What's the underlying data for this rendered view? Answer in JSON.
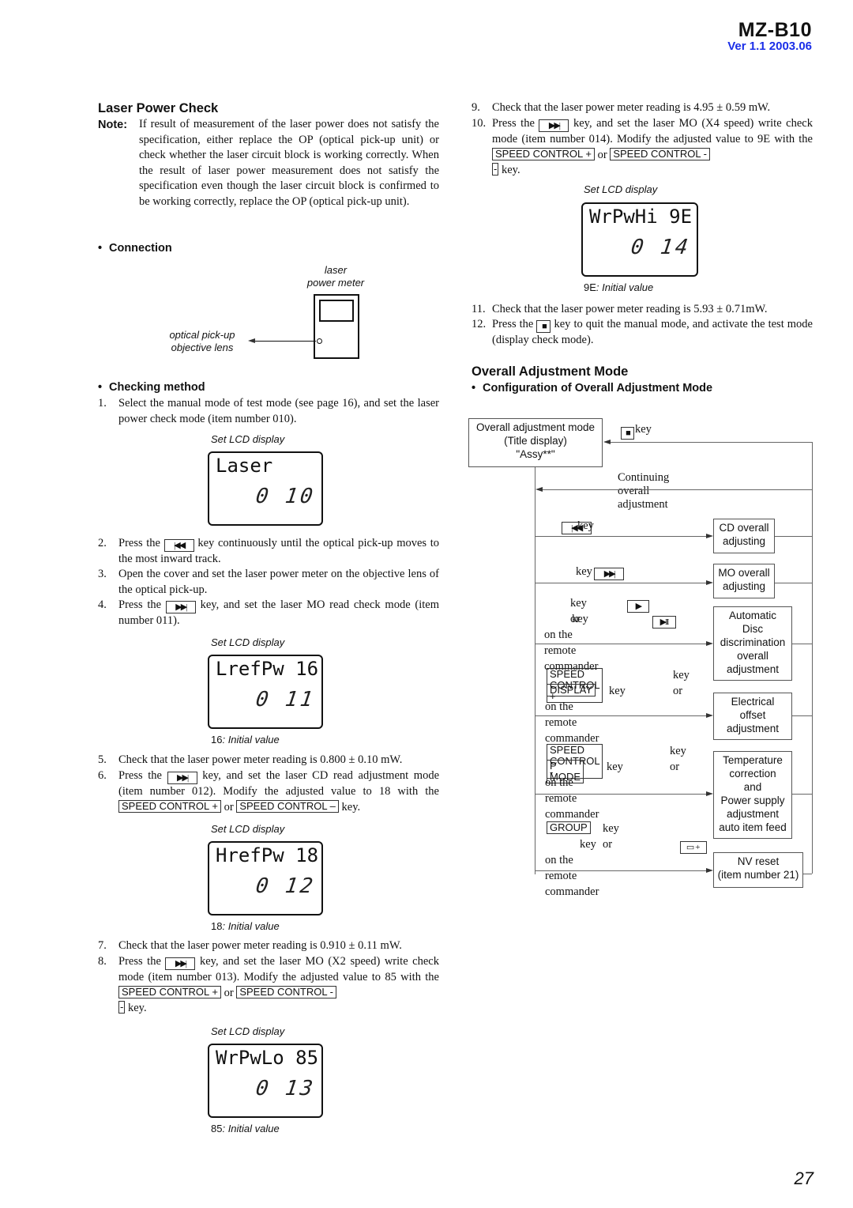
{
  "header": {
    "model": "MZ-B10",
    "version": "Ver 1.1  2003.06"
  },
  "laser_power_check": {
    "title": "Laser Power Check",
    "note_label": "Note:",
    "note_text": "If result of measurement of the laser power does not satisfy the specification, either replace the OP (optical pick-up unit) or check whether the laser circuit block is working correctly. When the result of laser power measurement does not satisfy the specification even though the laser circuit block is confirmed to be working correctly, replace the OP (optical pick-up unit).",
    "connection": {
      "heading": "Connection",
      "meter_label_1": "laser",
      "meter_label_2": "power meter",
      "lens_label_1": "optical pick-up",
      "lens_label_2": "objective lens"
    },
    "checking_method": {
      "heading": "Checking method",
      "steps": [
        {
          "num": "1.",
          "text": "Select the manual mode of test mode (see page 16), and set the laser power check mode (item number 010)."
        },
        {
          "num": "2.",
          "pre": "Press the",
          "key": "prev-track",
          "post": "key continuously until the optical pick-up moves to the most inward track."
        },
        {
          "num": "3.",
          "text": "Open the cover and set the laser power meter on the objective lens of the optical pick-up."
        },
        {
          "num": "4.",
          "pre": "Press the",
          "key": "next-track",
          "post": "key, and set the laser MO read check mode (item number 011)."
        },
        {
          "num": "5.",
          "text": "Check that the laser power meter reading is 0.800 ± 0.10 mW."
        },
        {
          "num": "6.",
          "pre": "Press the",
          "key": "next-track",
          "post": "key, and set the laser CD read adjustment mode (item number 012). Modify the adjusted value to 18 with the",
          "key2": "SPEED CONTROL +",
          "mid": "or",
          "key3": "SPEED CONTROL –",
          "end": "key."
        },
        {
          "num": "7.",
          "text": "Check that the laser power meter reading is 0.910 ± 0.11 mW."
        },
        {
          "num": "8.",
          "pre": "Press the",
          "key": "next-track",
          "post": "key, and set the laser MO (X2 speed) write check mode (item number 013). Modify the adjusted value to 85 with the",
          "key2": "SPEED CONTROL +",
          "mid": "or",
          "key3": "SPEED CONTROL -",
          "key3b": "-",
          "end": "key."
        },
        {
          "num": "9.",
          "text": "Check that the laser power meter reading is 4.95 ± 0.59 mW."
        },
        {
          "num": "10.",
          "pre": "Press the",
          "key": "next-track",
          "post": "key, and set the laser MO (X4 speed) write check mode (item number 014). Modify the adjusted value to 9E with the",
          "key2": "SPEED CONTROL +",
          "mid": "or",
          "key3": "SPEED CONTROL -",
          "key3b": "-",
          "end": "key."
        },
        {
          "num": "11.",
          "text": "Check that the laser power meter reading is 5.93 ± 0.71mW."
        },
        {
          "num": "12.",
          "pre": "Press the",
          "key": "stop",
          "post": "key to quit the manual mode, and activate the test mode (display check mode)."
        }
      ]
    },
    "lcd_caption": "Set LCD display",
    "lcds": [
      {
        "line1": "Laser",
        "line2": "0 10",
        "initial": "",
        "initial_label": ""
      },
      {
        "line1": "LrefPw 16",
        "line2": "0 11",
        "initial": "16",
        "initial_label": ": Initial value"
      },
      {
        "line1": "HrefPw 18",
        "line2": "0 12",
        "initial": "18",
        "initial_label": ": Initial value"
      },
      {
        "line1": "WrPwLo 85",
        "line2": "0 13",
        "initial": "85",
        "initial_label": ": Initial value"
      },
      {
        "line1": "WrPwHi 9E",
        "line2": "0 14",
        "initial": "9E",
        "initial_label": ": Initial value"
      }
    ]
  },
  "overall_adjustment": {
    "title": "Overall Adjustment Mode",
    "subheading": "Configuration of Overall Adjustment Mode",
    "title_box": [
      "Overall adjustment mode",
      "(Title display)",
      "\"Assy**\""
    ],
    "stop_key_label": "key",
    "continuing_label": "Continuing overall adjustment",
    "rows": [
      {
        "inputs": [
          {
            "key_icon": "prev-track",
            "text": "key"
          }
        ],
        "box": [
          "CD overall",
          "adjusting"
        ]
      },
      {
        "inputs": [
          {
            "key_icon": "next-track",
            "text": "key"
          }
        ],
        "box": [
          "MO overall",
          "adjusting"
        ]
      },
      {
        "inputs": [
          {
            "key_icon": "play",
            "text": "key or"
          },
          {
            "key_icon": "play-pause",
            "text": "key"
          },
          {
            "text": "on the remote commander"
          }
        ],
        "box": [
          "Automatic",
          "Disc",
          "discrimination",
          "overall",
          "adjustment"
        ]
      },
      {
        "inputs": [
          {
            "key": "SPEED CONTROL +",
            "text": "key or"
          },
          {
            "key": "DISPLAY",
            "text": "key"
          },
          {
            "text": "on the remote commander"
          }
        ],
        "box": [
          "Electrical",
          "offset",
          "adjustment"
        ]
      },
      {
        "inputs": [
          {
            "key": "SPEED CONTROL -",
            "text": "key or"
          },
          {
            "key": "P MODE",
            "text": "key"
          },
          {
            "text": "on the remote commander"
          }
        ],
        "box": [
          "Temperature",
          "correction",
          "and",
          "Power supply",
          "adjustment",
          "auto item feed"
        ]
      },
      {
        "inputs": [
          {
            "key": "GROUP",
            "text": "key or"
          },
          {
            "key_icon": "folder-plus",
            "text": "key"
          },
          {
            "text": "on the remote commander"
          }
        ],
        "box": [
          "NV reset",
          "(item number 21)"
        ]
      }
    ]
  },
  "page_number": "27"
}
